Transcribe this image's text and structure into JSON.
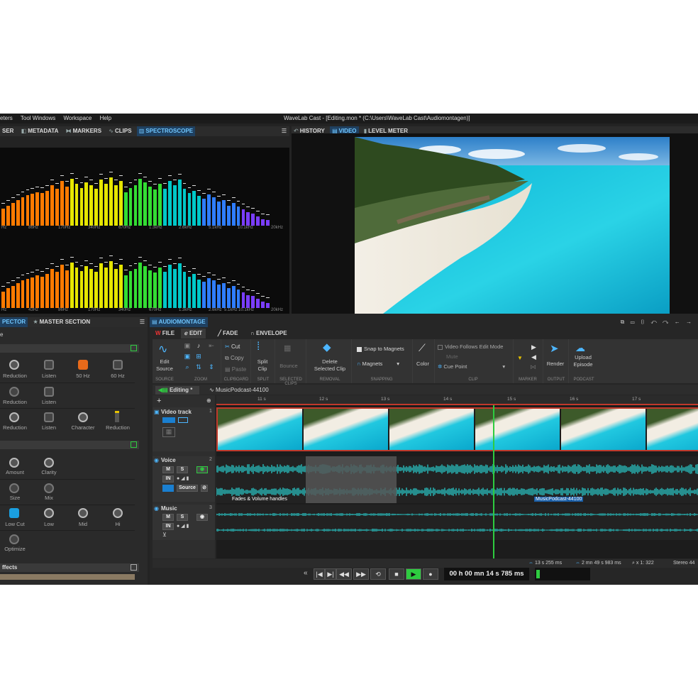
{
  "window": {
    "title": "WaveLab Cast - [Editing.mon * (C:\\Users\\WaveLab Cast\\Audiomontagen)]",
    "menu": [
      "eters",
      "Tool Windows",
      "Workspace",
      "Help"
    ]
  },
  "top_left_tabs": [
    "SER",
    "METADATA",
    "MARKERS",
    "CLIPS",
    "SPECTROSCOPE"
  ],
  "spectroscope": {
    "freq_labels_top": [
      "Hz",
      "86Hz",
      "170Hz",
      "340Hz",
      "670Hz",
      "1.3kHz",
      "2.6kHz",
      "5.1kHz",
      "10.1kHz",
      "20kHz"
    ],
    "freq_labels_bottom": [
      "Hz",
      "43Hz",
      "86Hz",
      "170Hz",
      "340Hz",
      "670Hz",
      "1.3kHz",
      "2.6kHz",
      "5.1kHz",
      "10.1kHz",
      "20kHz"
    ],
    "bars": [
      0.25,
      0.3,
      0.34,
      0.38,
      0.42,
      0.45,
      0.47,
      0.5,
      0.48,
      0.52,
      0.6,
      0.55,
      0.66,
      0.58,
      0.7,
      0.62,
      0.56,
      0.64,
      0.6,
      0.55,
      0.68,
      0.62,
      0.72,
      0.6,
      0.66,
      0.5,
      0.56,
      0.6,
      0.7,
      0.64,
      0.58,
      0.54,
      0.62,
      0.55,
      0.66,
      0.6,
      0.68,
      0.55,
      0.48,
      0.52,
      0.44,
      0.4,
      0.46,
      0.42,
      0.36,
      0.38,
      0.3,
      0.34,
      0.28,
      0.24,
      0.2,
      0.18,
      0.14,
      0.1,
      0.08
    ]
  },
  "top_right_tabs": [
    "HISTORY",
    "VIDEO",
    "LEVEL METER"
  ],
  "left_panel": {
    "tabs": [
      "PECTOR",
      "MASTER SECTION"
    ],
    "first_row_label": "e",
    "section1_rows": [
      [
        "Reduction",
        "Listen",
        "50 Hz",
        "60 Hz"
      ],
      [
        "Reduction",
        "Listen"
      ],
      [
        "Reduction",
        "Listen",
        "Character",
        "Reduction"
      ]
    ],
    "section2_rows": [
      [
        "Amount",
        "Clarity"
      ],
      [
        "Size",
        "Mix"
      ],
      [
        "Low Cut",
        "Low",
        "Mid",
        "Hi"
      ],
      [
        "Optimize"
      ]
    ],
    "effects_label": "ffects"
  },
  "montage": {
    "title": "AUDIOMONTAGE",
    "ribbon_tabs": [
      "FILE",
      "EDIT",
      "FADE",
      "ENVELOPE"
    ],
    "ribbon": {
      "edit_source": "Edit\nSource",
      "cut": "Cut",
      "copy": "Copy",
      "paste": "Paste",
      "split_clip": "Split\nClip",
      "bounce": "Bounce",
      "delete_selected_clip": "Delete\nSelected Clip",
      "snap_to_magnets": "Snap to Magnets",
      "magnets": "Magnets",
      "color": "Color",
      "video_follows_edit_mode": "Video Follows Edit Mode",
      "mute": "Mute",
      "cue_point": "Cue Point",
      "render": "Render",
      "upload_episode": "Upload\nEpisode"
    },
    "group_labels": [
      "SOURCE",
      "ZOOM",
      "CLIPBOARD",
      "SPLIT",
      "SELECTED CLIPS",
      "REMOVAL",
      "SNAPPING",
      "CLIP",
      "MARKER",
      "OUTPUT",
      "PODCAST"
    ],
    "doc_tabs": [
      "Editing *",
      "MusicPodcast-44100"
    ],
    "ruler": [
      "11 s",
      "12 s",
      "13 s",
      "14 s",
      "15 s",
      "16 s",
      "17 s"
    ],
    "tracks": [
      {
        "name": "Video track",
        "number": "1"
      },
      {
        "name": "Voice",
        "number": "2"
      },
      {
        "name": "Music",
        "number": "3"
      }
    ],
    "track_buttons": {
      "m": "M",
      "s": "S",
      "in": "IN",
      "source": "Source"
    },
    "fade_label": "Fades & Volume handles",
    "clip_label": "MusicPodcast-44100",
    "status": [
      "13 s 255 ms",
      "2 mn 49 s 983 ms",
      "x 1: 322",
      "Stereo 44"
    ]
  },
  "transport": {
    "time": "00 h 00 mn 14 s 785 ms",
    "buttons": [
      "«",
      "|◀",
      "▶|",
      "◀◀",
      "▶▶",
      "⟲",
      "■",
      "▶",
      "●"
    ]
  }
}
